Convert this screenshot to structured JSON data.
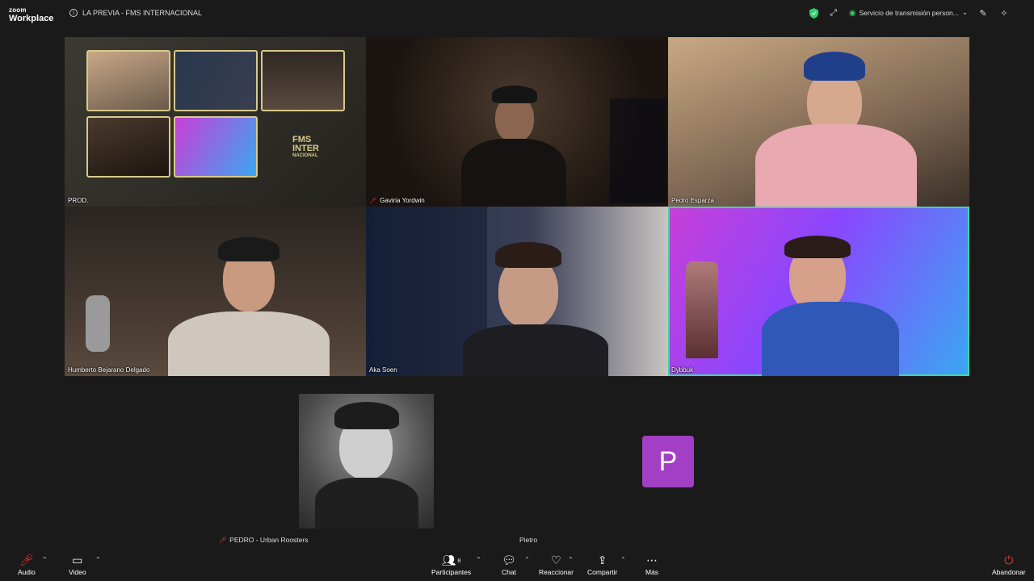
{
  "app": {
    "logo_top": "zoom",
    "logo_bottom": "Workplace",
    "meeting_title": "LA PREVIA - FMS INTERNACIONAL",
    "stream_label": "Servicio de transmisión person..."
  },
  "tiles": [
    {
      "name": "PROD."
    },
    {
      "name": "Gaviria Yordwin"
    },
    {
      "name": "Pedro Esparza"
    },
    {
      "name": "Humberto Bejarano Delgado"
    },
    {
      "name": "Aka Soen"
    },
    {
      "name": "Dybbuk"
    }
  ],
  "prod_brand": {
    "line1": "FMS",
    "line2": "INTER",
    "line3": "NACIONAL"
  },
  "bottom": {
    "left_name": "PEDRO - Urban Roosters",
    "right_name": "Pietro",
    "right_initial": "P"
  },
  "toolbar": {
    "audio": "Audio",
    "video": "Video",
    "participants": "Participantes",
    "participants_count": "8",
    "chat": "Chat",
    "react": "Reaccionar",
    "share": "Compartir",
    "more": "Más",
    "leave": "Abandonar"
  },
  "colors": {
    "active_speaker": "#3fd6a6",
    "muted": "#e8383d",
    "avatar_bg": "#a23fc4",
    "security_shield": "#2bd26b"
  }
}
